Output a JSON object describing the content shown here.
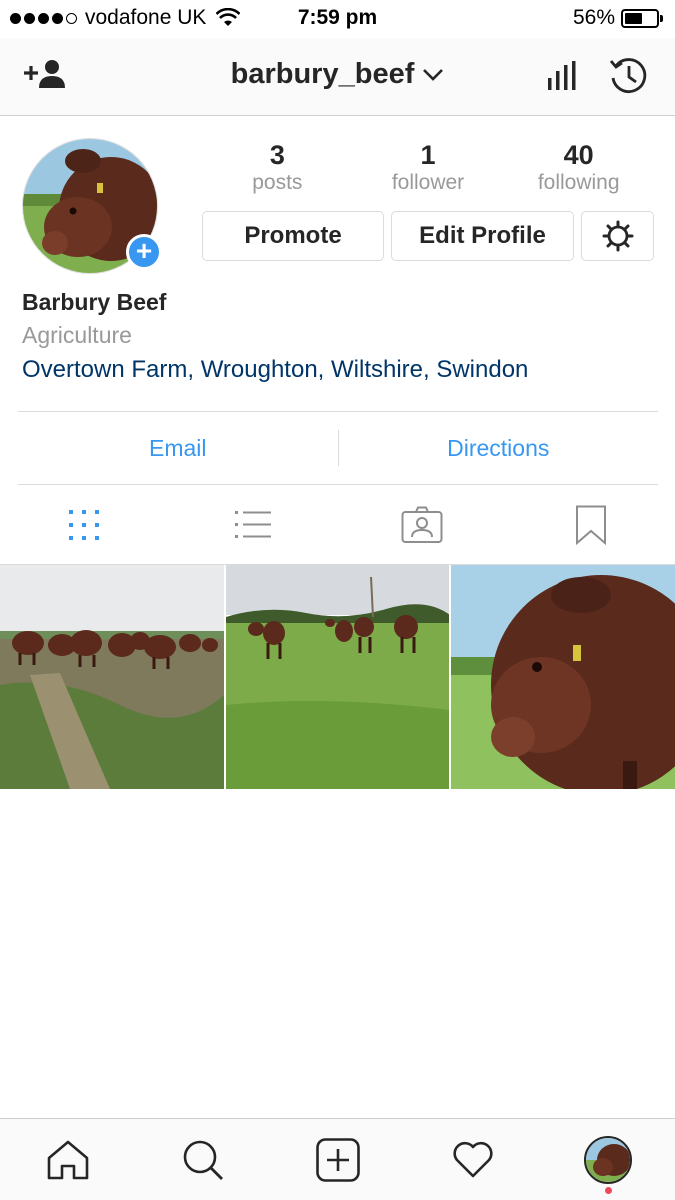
{
  "status_bar": {
    "carrier": "vodafone UK",
    "time": "7:59 pm",
    "battery_percent": "56%",
    "battery_level": 0.56,
    "signal_bars": 4
  },
  "nav": {
    "username": "barbury_beef",
    "add_person_icon": "add-person-icon",
    "insights_icon": "bar-chart-icon",
    "archive_icon": "history-clock-icon"
  },
  "profile": {
    "display_name": "Barbury Beef",
    "category": "Agriculture",
    "location": "Overtown Farm, Wroughton, Wiltshire, Swindon",
    "stats": [
      {
        "value": "3",
        "label": "posts"
      },
      {
        "value": "1",
        "label": "follower"
      },
      {
        "value": "40",
        "label": "following"
      }
    ],
    "buttons": {
      "promote": "Promote",
      "edit_profile": "Edit Profile"
    },
    "contact": {
      "email": "Email",
      "directions": "Directions"
    }
  },
  "view_tabs": [
    {
      "icon": "grid-icon",
      "active": true
    },
    {
      "icon": "list-icon",
      "active": false
    },
    {
      "icon": "tagged-photos-icon",
      "active": false
    },
    {
      "icon": "bookmark-icon",
      "active": false
    }
  ],
  "tab_bar": [
    {
      "icon": "home-icon"
    },
    {
      "icon": "search-icon"
    },
    {
      "icon": "add-post-icon"
    },
    {
      "icon": "heart-icon"
    },
    {
      "icon": "profile-avatar-icon"
    }
  ],
  "colors": {
    "accent_blue": "#3897f0",
    "link_navy": "#003569",
    "muted_gray": "#999999",
    "notification_red": "#ed4956"
  }
}
